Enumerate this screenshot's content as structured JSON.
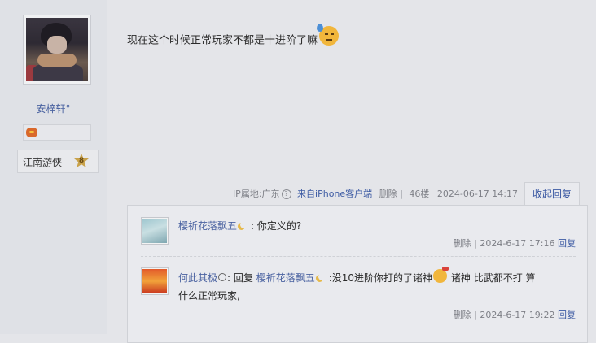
{
  "user": {
    "name": "安梓轩°",
    "rank_title": "江南游侠",
    "rank_level": "8"
  },
  "post": {
    "text": "现在这个时候正常玩家不都是十进阶了嘛",
    "ip": "IP属地:广东",
    "source": "来自iPhone客户端",
    "delete": "删除 |",
    "floor": "46楼",
    "date": "2024-06-17 14:17",
    "collapse_label": "收起回复"
  },
  "replies": [
    {
      "author": "樱祈花落飘五",
      "text": ": 你定义的?",
      "delete": "删除",
      "date": "| 2024-6-17 17:16",
      "reply_label": "回复"
    },
    {
      "author": "何此其极",
      "reply_word": ": 回复",
      "reply_to": "樱祈花落飘五",
      "text_part1": ":没10进阶你打的了诸神",
      "text_part2": "诸神 比武都不打 算",
      "text_line2": "什么正常玩家,",
      "delete": "删除",
      "date": "| 2024-6-17 19:22",
      "reply_label": "回复"
    }
  ]
}
